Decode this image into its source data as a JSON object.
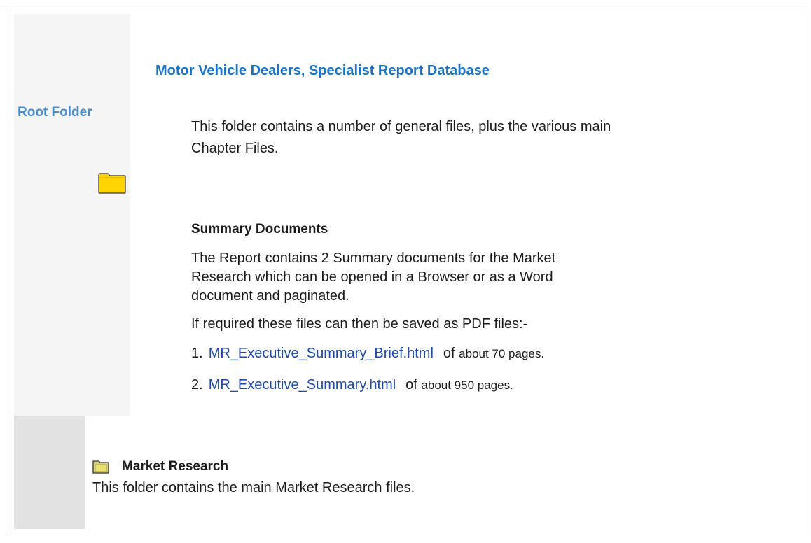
{
  "sidebar": {
    "root_folder_label": "Root Folder"
  },
  "main": {
    "title": "Motor Vehicle Dealers, Specialist Report Database",
    "intro": "This folder contains a number of general files, plus the various main Chapter Files.",
    "summary_heading": "Summary Documents",
    "summary_description": "The Report contains 2 Summary documents for the Market Research which can be opened in a Browser or as a Word document and paginated.",
    "pdf_note": "If required these files can then be saved as PDF files:-",
    "files": [
      {
        "number": "1.",
        "name": "MR_Executive_Summary_Brief.html",
        "of": "of",
        "pages": "about 70 pages."
      },
      {
        "number": "2.",
        "name": "MR_Executive_Summary.html",
        "of": "of",
        "pages": "about 950 pages."
      }
    ]
  },
  "market_research": {
    "heading": "Market Research",
    "description": "This folder contains the main Market Research files."
  },
  "colors": {
    "title": "#1a73c6",
    "root_folder_label": "#4a8ccd",
    "link": "#1f4aa8",
    "sidebar_top_bg": "#f5f5f5",
    "sidebar_bottom_bg": "#e2e2e2"
  },
  "icons": {
    "root_folder": "folder-icon",
    "market_research_folder": "folder-icon"
  }
}
